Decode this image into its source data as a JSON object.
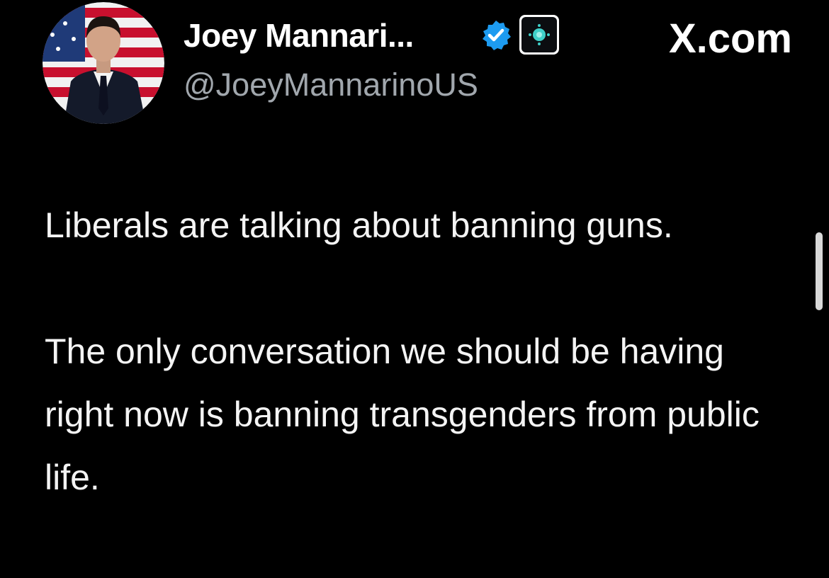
{
  "author": {
    "display_name": "Joey Mannari...",
    "handle": "@JoeyMannarinoUS",
    "avatar_icon": "profile-photo",
    "verified_icon": "verified-badge-icon",
    "affiliate_icon": "affiliate-badge-icon"
  },
  "site": {
    "label": "X.com"
  },
  "tweet": {
    "paragraph_1": "Liberals are talking about banning guns.",
    "paragraph_2": "The only conversation we should be having right now is banning transgenders from public life."
  },
  "colors": {
    "background": "#000000",
    "text": "#ffffff",
    "handle": "#a1a7ad",
    "verified": "#1d9bf0",
    "affiliate_accent": "#3fd0c9"
  }
}
